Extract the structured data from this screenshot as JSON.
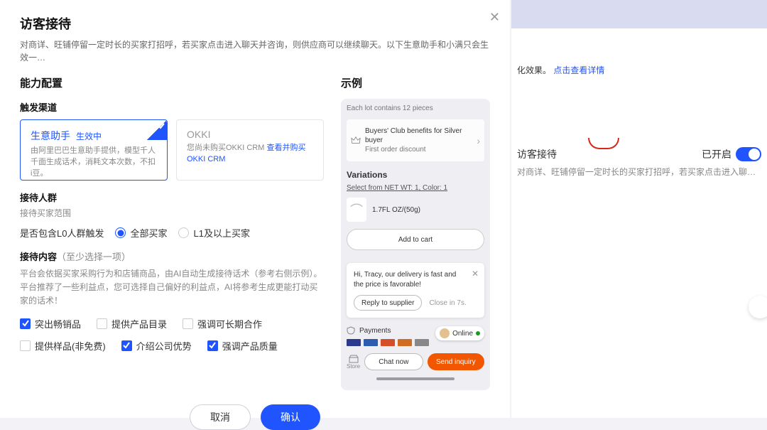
{
  "background": {
    "promo_suffix": "化效果。",
    "promo_link": "点击查看详情",
    "card_title": "访客接待",
    "status_label": "已开启",
    "card_sub": "对商详、旺铺停留一定时长的买家打招呼，若买家点击进入聊天…"
  },
  "modal": {
    "title": "访客接待",
    "subtitle": "对商详、旺铺停留一定时长的买家打招呼，若买家点击进入聊天并咨询，则供应商可以继续聊天。以下生意助手和小满只会生效一…",
    "section_config": "能力配置",
    "section_example": "示例",
    "channel_label": "触发渠道",
    "channels": [
      {
        "title": "生意助手",
        "badge": "生效中",
        "desc": "由阿里巴巴生意助手提供，模型千人千面生成话术，消耗文本次数，不扣i豆。"
      },
      {
        "title": "OKKI",
        "desc_prefix": "您尚未购买OKKI CRM ",
        "desc_link": "查看并购买OKKI CRM"
      }
    ],
    "audience_label": "接待人群",
    "audience_help": "接待买家范围",
    "radio_label": "是否包含L0人群触发",
    "radio_all": "全部买家",
    "radio_l1": "L1及以上买家",
    "content_label": "接待内容",
    "content_tag": "（至少选择一项）",
    "content_help": "平台会依据买家采购行为和店铺商品，由AI自动生成接待话术（参考右侧示例）。平台推荐了一些利益点，您可选择自己偏好的利益点，AI将参考生成更能打动买家的话术！",
    "checks": [
      {
        "label": "突出畅销品",
        "checked": true
      },
      {
        "label": "提供产品目录",
        "checked": false
      },
      {
        "label": "强调可长期合作",
        "checked": false
      },
      {
        "label": "提供样品(非免费)",
        "checked": false
      },
      {
        "label": "介绍公司优势",
        "checked": true
      },
      {
        "label": "强调产品质量",
        "checked": true
      }
    ],
    "cancel": "取消",
    "confirm": "确认"
  },
  "preview": {
    "lot": "Each lot contains 12 pieces",
    "club_line": "Buyers' Club benefits for Silver buyer",
    "club_sub": "First order discount",
    "variations": "Variations",
    "select_from": "Select from NET WT: 1, Color: 1",
    "variant_text": "1.7FL OZ/(50g)",
    "add_to_cart": "Add to cart",
    "chat_msg": "Hi, Tracy, our delivery is fast and the price is favorable!",
    "reply": "Reply to supplier",
    "close_in": "Close in 7s.",
    "payments": "Payments",
    "online": "Online",
    "paylogos": [
      "PayPal",
      "VISA",
      "MC",
      "AE",
      "JCB"
    ],
    "store": "Store",
    "chat_now": "Chat now",
    "send_inquiry": "Send inquiry"
  }
}
